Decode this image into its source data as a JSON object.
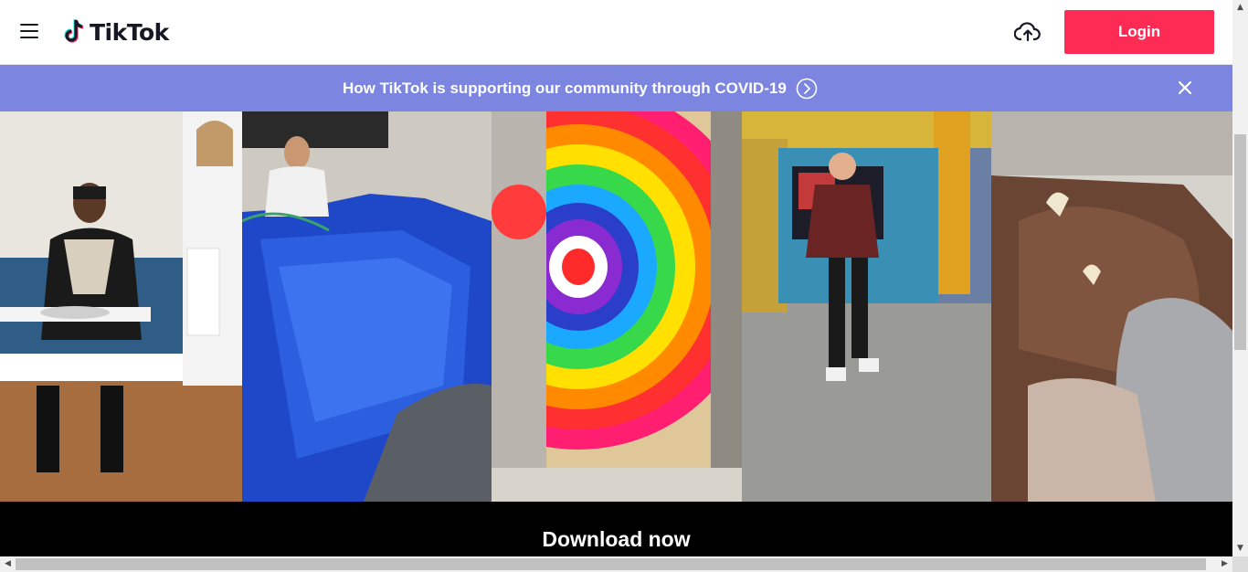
{
  "header": {
    "logo_text": "TikTok",
    "login_label": "Login",
    "accent_color": "#fe2c55"
  },
  "banner": {
    "text": "How TikTok is supporting our community through COVID-19",
    "background": "#7c85e0"
  },
  "videos": [
    {
      "icon": "video-thumbnail-man-eating"
    },
    {
      "icon": "video-thumbnail-pool"
    },
    {
      "icon": "video-thumbnail-paint-pour"
    },
    {
      "icon": "video-thumbnail-man-dancing"
    },
    {
      "icon": "video-thumbnail-bison"
    }
  ],
  "download": {
    "title": "Download now"
  },
  "scrollbars": {
    "vertical_up": "▲",
    "vertical_down": "▼",
    "horizontal_left": "◀",
    "horizontal_right": "▶"
  }
}
